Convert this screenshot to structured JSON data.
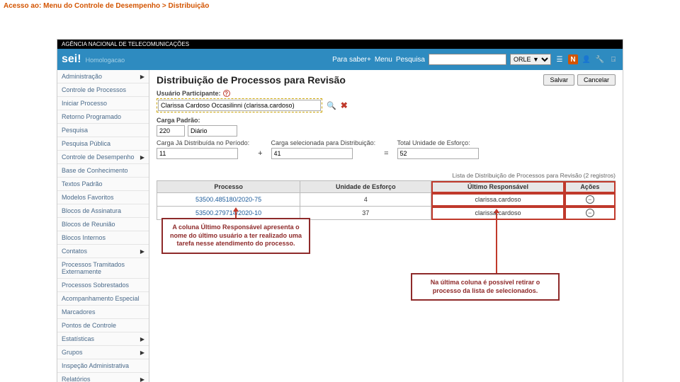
{
  "instruction": "Acesso ao: Menu do Controle de Desempenho > Distribuição",
  "blackbar": "AGÊNCIA NACIONAL DE TELECOMUNICAÇÕES",
  "logo": {
    "text": "sei!",
    "sub": "Homologacao"
  },
  "topbar": {
    "parasaber": "Para saber+",
    "menu": "Menu",
    "pesquisa": "Pesquisa",
    "search_value": "",
    "unit": "ORLE ▼"
  },
  "sidebar": {
    "items": [
      {
        "label": "Administração",
        "arrow": true
      },
      {
        "label": "Controle de Processos",
        "arrow": false
      },
      {
        "label": "Iniciar Processo",
        "arrow": false
      },
      {
        "label": "Retorno Programado",
        "arrow": false
      },
      {
        "label": "Pesquisa",
        "arrow": false
      },
      {
        "label": "Pesquisa Pública",
        "arrow": false
      },
      {
        "label": "Controle de Desempenho",
        "arrow": true
      },
      {
        "label": "Base de Conhecimento",
        "arrow": false
      },
      {
        "label": "Textos Padrão",
        "arrow": false
      },
      {
        "label": "Modelos Favoritos",
        "arrow": false
      },
      {
        "label": "Blocos de Assinatura",
        "arrow": false
      },
      {
        "label": "Blocos de Reunião",
        "arrow": false
      },
      {
        "label": "Blocos Internos",
        "arrow": false
      },
      {
        "label": "Contatos",
        "arrow": true
      },
      {
        "label": "Processos Tramitados Externamente",
        "arrow": false
      },
      {
        "label": "Processos Sobrestados",
        "arrow": false
      },
      {
        "label": "Acompanhamento Especial",
        "arrow": false
      },
      {
        "label": "Marcadores",
        "arrow": false
      },
      {
        "label": "Pontos de Controle",
        "arrow": false
      },
      {
        "label": "Estatísticas",
        "arrow": true
      },
      {
        "label": "Grupos",
        "arrow": true
      },
      {
        "label": "Inspeção Administrativa",
        "arrow": false
      },
      {
        "label": "Relatórios",
        "arrow": true
      }
    ]
  },
  "main": {
    "title": "Distribuição de Processos para Revisão",
    "save": "Salvar",
    "cancel": "Cancelar",
    "usuario_label": "Usuário Participante:",
    "usuario_value": "Clarissa Cardoso Occasilinni (clarissa.cardoso)",
    "carga_label": "Carga Padrão:",
    "carga_num": "220",
    "carga_sel": "Diário",
    "dist_label": "Carga Já Distribuída no Período:",
    "dist_val": "11",
    "sel_label": "Carga selecionada para Distribuição:",
    "sel_val": "41",
    "tot_label": "Total Unidade de Esforço:",
    "tot_val": "52",
    "caption": "Lista de Distribuição de Processos para Revisão (2 registros)",
    "headers": {
      "c1": "Processo",
      "c2": "Unidade de Esforço",
      "c3": "Último Responsável",
      "c4": "Ações"
    },
    "rows": [
      {
        "proc": "53500.485180/2020-75",
        "ue": "4",
        "resp": "clarissa.cardoso"
      },
      {
        "proc": "53500.279714/2020-10",
        "ue": "37",
        "resp": "clarissa.cardoso"
      }
    ]
  },
  "callouts": {
    "c1": "A coluna Último Responsável apresenta o nome do último usuário a ter realizado uma tarefa nesse atendimento do processo.",
    "c2": "Na última coluna é possível retirar o processo da lista de selecionados."
  }
}
